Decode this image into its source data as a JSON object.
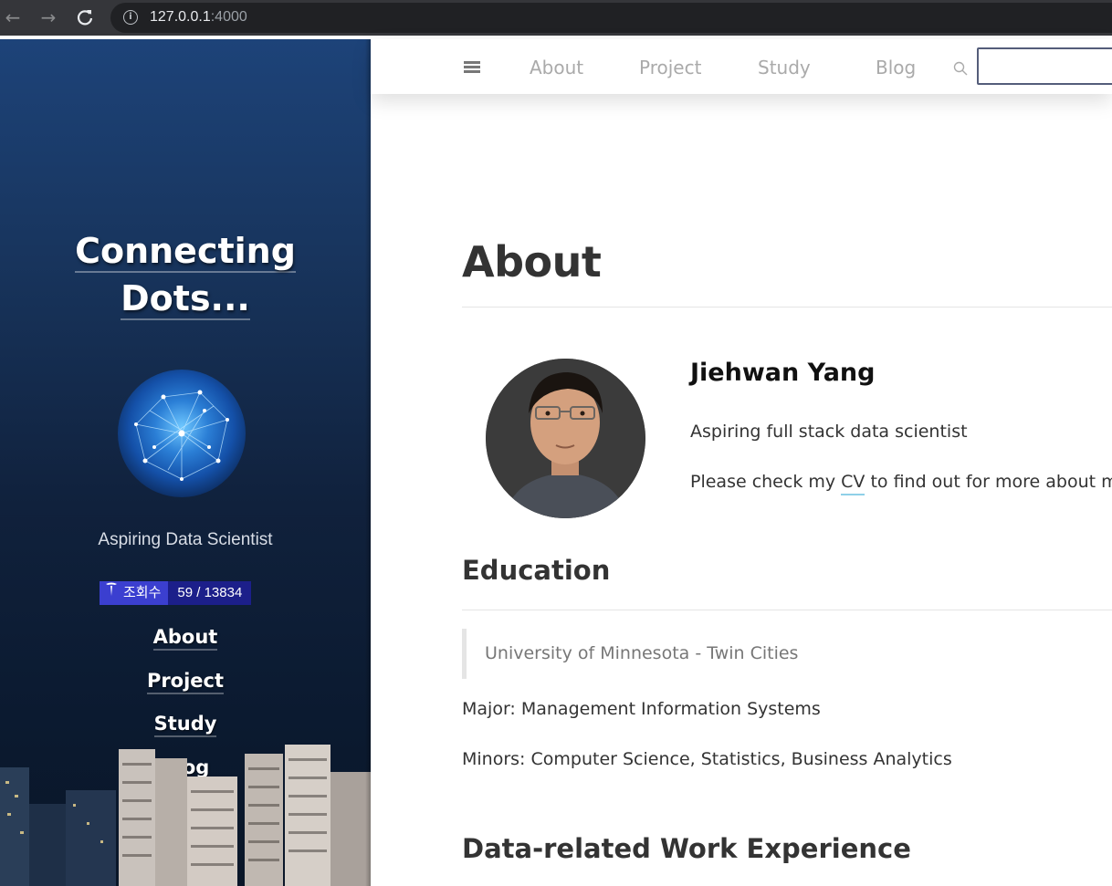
{
  "browser": {
    "url_host": "127.0.0.1",
    "url_port": ":4000"
  },
  "sidebar": {
    "title_line1": "Connecting",
    "title_line2": "Dots...",
    "tagline": "Aspiring Data Scientist",
    "counter_label": "조회수",
    "counter_value": "59 / 13834",
    "nav": [
      {
        "label": "About"
      },
      {
        "label": "Project"
      },
      {
        "label": "Study"
      },
      {
        "label": "Blog"
      }
    ]
  },
  "topnav": {
    "links": [
      {
        "label": "About"
      },
      {
        "label": "Project"
      },
      {
        "label": "Study"
      },
      {
        "label": "Blog"
      }
    ],
    "search_value": ""
  },
  "main": {
    "title": "About",
    "profile": {
      "name": "Jiehwan Yang",
      "bio1": "Aspiring full stack data scientist",
      "bio2_before": "Please check my ",
      "bio2_link": "CV",
      "bio2_after": " to find out for more about me"
    },
    "education": {
      "heading": "Education",
      "school": "University of Minnesota - Twin Cities",
      "major": "Major: Management Information Systems",
      "minors": "Minors: Computer Science, Statistics, Business Analytics"
    },
    "work_heading": "Data-related Work Experience"
  },
  "colors": {
    "sidebar_top": "#1d4379",
    "sidebar_bottom": "#0a1628",
    "counter_label_bg": "#3b3fd0",
    "counter_value_bg": "#1c1f8a",
    "link_underline": "#8fd0e8"
  }
}
